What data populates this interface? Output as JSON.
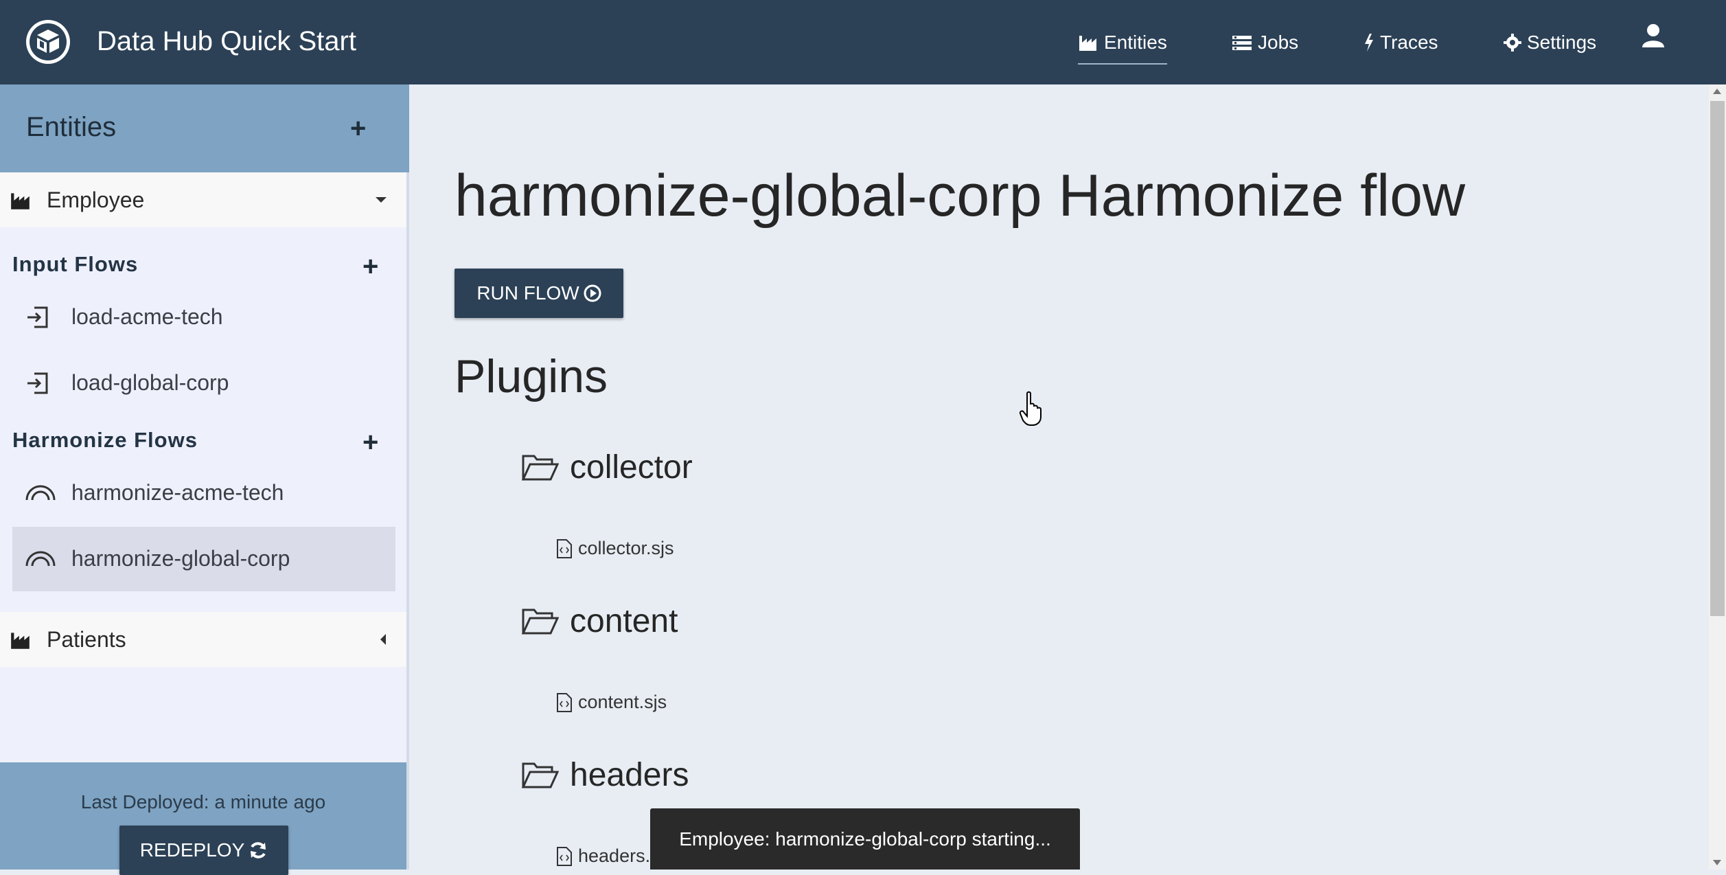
{
  "header": {
    "app_title": "Data Hub Quick Start",
    "nav": [
      {
        "label": "Entities",
        "icon": "factory-icon",
        "active": true
      },
      {
        "label": "Jobs",
        "icon": "list-icon",
        "active": false
      },
      {
        "label": "Traces",
        "icon": "bolt-icon",
        "active": false
      },
      {
        "label": "Settings",
        "icon": "gear-icon",
        "active": false
      }
    ],
    "user_icon": "user-icon",
    "colors": {
      "background": "#2c4156",
      "text": "#ffffff"
    }
  },
  "sidebar": {
    "title": "Entities",
    "entities": [
      {
        "name": "Employee",
        "expanded": true,
        "input_flows_title": "Input Flows",
        "input_flows": [
          "load-acme-tech",
          "load-global-corp"
        ],
        "harmonize_flows_title": "Harmonize Flows",
        "harmonize_flows": [
          "harmonize-acme-tech",
          "harmonize-global-corp"
        ],
        "selected_flow": "harmonize-global-corp"
      },
      {
        "name": "Patients",
        "expanded": false
      }
    ],
    "footer": {
      "last_deployed": "Last Deployed: a minute ago",
      "redeploy_label": "REDEPLOY"
    },
    "colors": {
      "header": "#7ea3c3",
      "background": "#eef0fb",
      "selected": "#dadcea"
    }
  },
  "main": {
    "title": "harmonize-global-corp Harmonize flow",
    "run_flow_label": "RUN FLOW",
    "plugins_title": "Plugins",
    "plugins": [
      {
        "folder": "collector",
        "file": "collector.sjs"
      },
      {
        "folder": "content",
        "file": "content.sjs"
      },
      {
        "folder": "headers",
        "file": "headers.sjs"
      }
    ]
  },
  "toast": {
    "message": "Employee: harmonize-global-corp starting..."
  }
}
